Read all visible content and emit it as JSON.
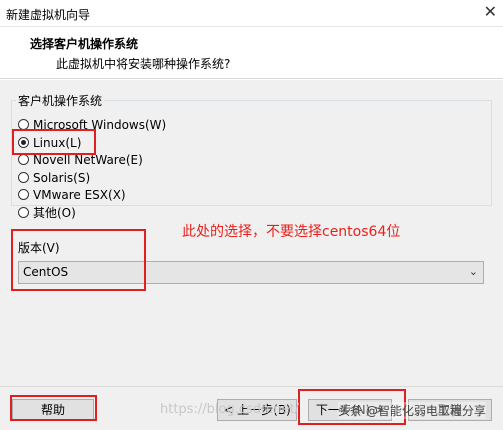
{
  "window": {
    "title": "新建虚拟机向导",
    "close_glyph": "✕"
  },
  "header": {
    "title": "选择客户机操作系统",
    "subtitle": "此虚拟机中将安装哪种操作系统?"
  },
  "guest_os": {
    "group_label": "客户机操作系统",
    "options": [
      {
        "label": "Microsoft Windows(W)",
        "checked": false
      },
      {
        "label": "Linux(L)",
        "checked": true
      },
      {
        "label": "Novell NetWare(E)",
        "checked": false
      },
      {
        "label": "Solaris(S)",
        "checked": false
      },
      {
        "label": "VMware ESX(X)",
        "checked": false
      },
      {
        "label": "其他(O)",
        "checked": false
      }
    ]
  },
  "annotation": "此处的选择，不要选择centos64位",
  "version": {
    "label": "版本(V)",
    "selected": "CentOS",
    "arrow_icon": "chevron-down-icon",
    "arrow_glyph": "⌄"
  },
  "footer": {
    "help": "帮助",
    "back": "< 上一步(B)",
    "next": "下一步(N) >",
    "cancel": "取消"
  },
  "watermark": "https://blog.csdn.net/",
  "credit": "头条 @智能化弱电工程分享",
  "colors": {
    "highlight_box": "#e02020",
    "annotation_text": "#e8211c",
    "content_bg": "#f0f0f0"
  }
}
